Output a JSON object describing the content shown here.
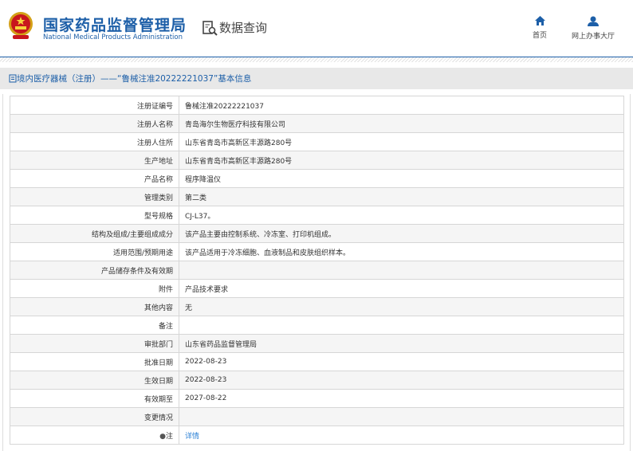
{
  "header": {
    "title_cn": "国家药品监督管理局",
    "title_en": "National Medical Products Administration",
    "data_query": "数据查询",
    "nav": [
      {
        "label": "首页",
        "icon": "home-icon"
      },
      {
        "label": "网上办事大厅",
        "icon": "user-icon"
      }
    ]
  },
  "breadcrumb": "境内医疗器械（注册）——“鲁械注准20222221037”基本信息",
  "rows": [
    {
      "label": "注册证编号",
      "value": "鲁械注准20222221037"
    },
    {
      "label": "注册人名称",
      "value": "青岛海尔生物医疗科技有限公司"
    },
    {
      "label": "注册人住所",
      "value": "山东省青岛市高新区丰源路280号"
    },
    {
      "label": "生产地址",
      "value": "山东省青岛市高新区丰源路280号"
    },
    {
      "label": "产品名称",
      "value": "程序降温仪"
    },
    {
      "label": "管理类别",
      "value": "第二类"
    },
    {
      "label": "型号规格",
      "value": "CJ-L37。"
    },
    {
      "label": "结构及组成/主要组成成分",
      "value": "该产品主要由控制系统、冷冻室、打印机组成。"
    },
    {
      "label": "适用范围/预期用途",
      "value": "该产品适用于冷冻细胞、血液制品和皮肤组织样本。"
    },
    {
      "label": "产品储存条件及有效期",
      "value": ""
    },
    {
      "label": "附件",
      "value": "产品技术要求"
    },
    {
      "label": "其他内容",
      "value": "无"
    },
    {
      "label": "备注",
      "value": ""
    },
    {
      "label": "审批部门",
      "value": "山东省药品监督管理局"
    },
    {
      "label": "批准日期",
      "value": "2022-08-23"
    },
    {
      "label": "生效日期",
      "value": "2022-08-23"
    },
    {
      "label": "有效期至",
      "value": "2027-08-22"
    },
    {
      "label": "变更情况",
      "value": ""
    },
    {
      "label": "注",
      "value": "详情"
    }
  ]
}
